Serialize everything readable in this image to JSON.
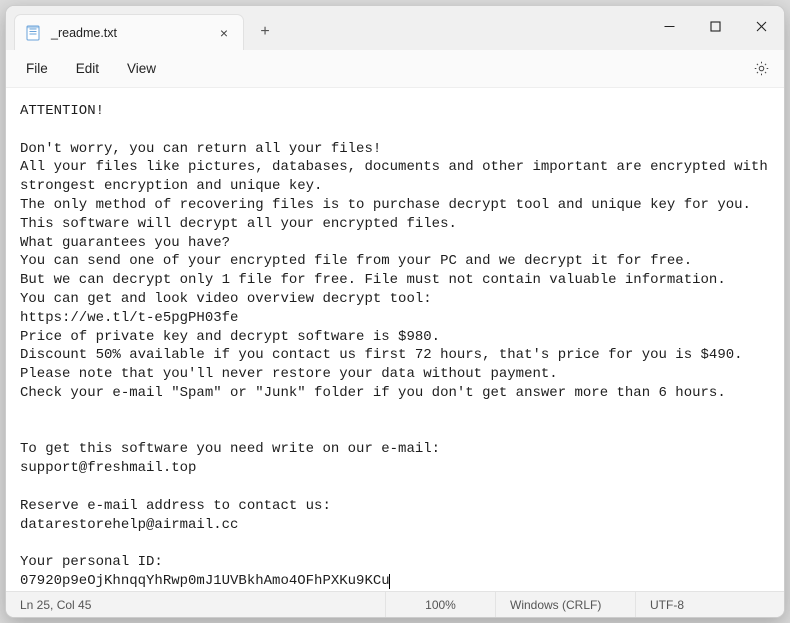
{
  "tab": {
    "title": "_readme.txt",
    "close": "×"
  },
  "newtab": "+",
  "menu": {
    "file": "File",
    "edit": "Edit",
    "view": "View"
  },
  "lines": [
    "ATTENTION!",
    "",
    "Don't worry, you can return all your files!",
    "All your files like pictures, databases, documents and other important are encrypted with strongest encryption and unique key.",
    "The only method of recovering files is to purchase decrypt tool and unique key for you.",
    "This software will decrypt all your encrypted files.",
    "What guarantees you have?",
    "You can send one of your encrypted file from your PC and we decrypt it for free.",
    "But we can decrypt only 1 file for free. File must not contain valuable information.",
    "You can get and look video overview decrypt tool:",
    "https://we.tl/t-e5pgPH03fe",
    "Price of private key and decrypt software is $980.",
    "Discount 50% available if you contact us first 72 hours, that's price for you is $490.",
    "Please note that you'll never restore your data without payment.",
    "Check your e-mail \"Spam\" or \"Junk\" folder if you don't get answer more than 6 hours.",
    "",
    "",
    "To get this software you need write on our e-mail:",
    "support@freshmail.top",
    "",
    "Reserve e-mail address to contact us:",
    "datarestorehelp@airmail.cc",
    "",
    "Your personal ID:",
    "07920p9eOjKhnqqYhRwp0mJ1UVBkhAmo4OFhPXKu9KCu"
  ],
  "status": {
    "pos": "Ln 25, Col 45",
    "zoom": "100%",
    "line_ending": "Windows (CRLF)",
    "encoding": "UTF-8"
  }
}
